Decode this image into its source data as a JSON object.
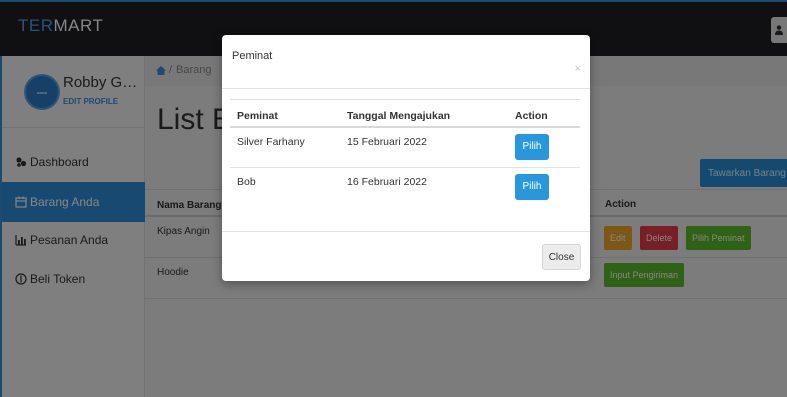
{
  "brand": {
    "prefix": "TER",
    "suffix": "MART"
  },
  "colors": {
    "accent": "#2f8fd8",
    "danger": "#e63a4a",
    "warning": "#efa82a",
    "success": "#5cbc2a",
    "topbar": "#1f1f24"
  },
  "user_menu": {
    "icon": "user-icon"
  },
  "sidebar": {
    "profile": {
      "name": "Robby Gust...",
      "edit_label": "EDIT PROFILE"
    },
    "items": [
      {
        "label": "Dashboard",
        "icon": "dashboard-icon",
        "active": false
      },
      {
        "label": "Barang Anda",
        "icon": "calendar-icon",
        "active": true
      },
      {
        "label": "Pesanan Anda",
        "icon": "bar-chart-icon",
        "active": false
      },
      {
        "label": "Beli Token",
        "icon": "token-icon",
        "active": false
      }
    ]
  },
  "breadcrumb": {
    "home_icon": "home-icon",
    "separator": "/",
    "current": "Barang"
  },
  "main": {
    "title": "List B",
    "offer_button": "Tawarkan Barang",
    "table": {
      "headers": {
        "nama": "Nama Barang",
        "action": "Action"
      },
      "rows": [
        {
          "nama": "Kipas Angin",
          "actions": [
            "Edit",
            "Delete",
            "Pilih Peminat"
          ]
        },
        {
          "nama": "Hoodie",
          "actions": [
            "Input Pengiriman"
          ]
        }
      ]
    }
  },
  "modal": {
    "title": "Peminat",
    "close_x": "×",
    "headers": [
      "Peminat",
      "Tanggal Mengajukan",
      "Action"
    ],
    "rows": [
      {
        "peminat": "Silver Farhany",
        "tanggal": "15 Februari 2022",
        "action": "Pilih"
      },
      {
        "peminat": "Bob",
        "tanggal": "16 Februari 2022",
        "action": "Pilih"
      }
    ],
    "close_button": "Close"
  }
}
